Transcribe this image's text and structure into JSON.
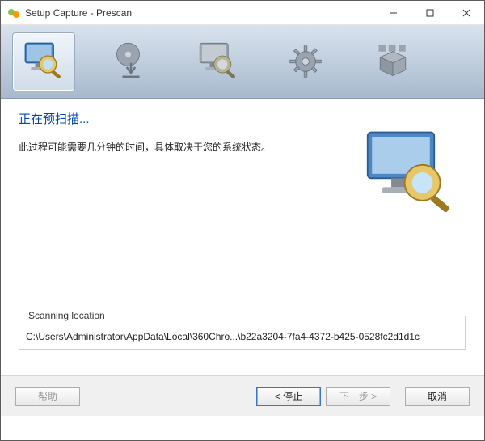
{
  "window": {
    "title": "Setup Capture - Prescan",
    "btn_min": "minimize",
    "btn_max": "maximize",
    "btn_close": "close"
  },
  "steps": [
    {
      "name": "prescan",
      "icon": "monitor-search",
      "active": true
    },
    {
      "name": "install",
      "icon": "disc-download",
      "active": false
    },
    {
      "name": "postscan",
      "icon": "monitor-search2",
      "active": false
    },
    {
      "name": "configure",
      "icon": "gear",
      "active": false
    },
    {
      "name": "package",
      "icon": "box-folder",
      "active": false
    }
  ],
  "main": {
    "heading": "正在预扫描...",
    "desc": "此过程可能需要几分钟的时间，具体取决于您的系统状态。"
  },
  "scan": {
    "group_title": "Scanning location",
    "path": "C:\\Users\\Administrator\\AppData\\Local\\360Chro...\\b22a3204-7fa4-4372-b425-0528fc2d1d1c"
  },
  "footer": {
    "help": "帮助",
    "stop": "< 停止",
    "next": "下一步 >",
    "cancel": "取消"
  }
}
